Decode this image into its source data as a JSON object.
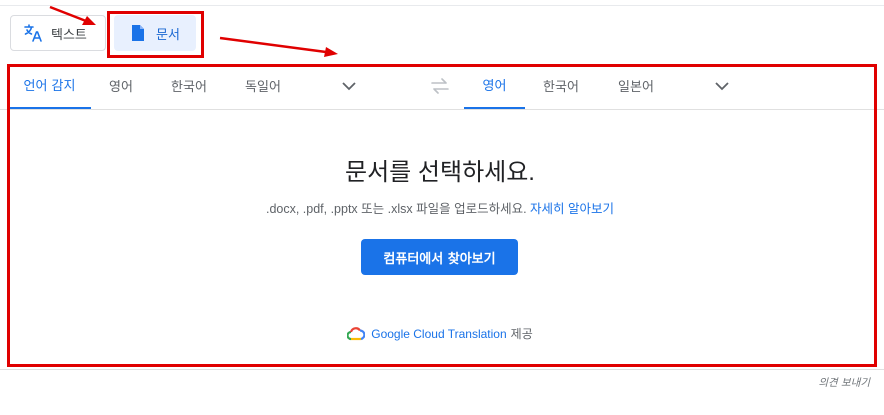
{
  "mode_tabs": {
    "text_label": "텍스트",
    "document_label": "문서"
  },
  "source_languages": [
    "언어 감지",
    "영어",
    "한국어",
    "독일어"
  ],
  "target_languages": [
    "영어",
    "한국어",
    "일본어"
  ],
  "dropzone": {
    "title": "문서를 선택하세요.",
    "subtitle": ".docx, .pdf, .pptx 또는 .xlsx 파일을 업로드하세요.",
    "learn_more": "자세히 알아보기",
    "browse_button": "컴퓨터에서 찾아보기"
  },
  "powered_by": {
    "link_text": "Google Cloud Translation",
    "suffix": "제공"
  },
  "feedback": "의견 보내기",
  "colors": {
    "accent": "#1a73e8",
    "annotation": "#e00000"
  },
  "icons": [
    "translate-icon",
    "document-icon",
    "chevron-down-icon",
    "swap-icon",
    "google-cloud-icon"
  ]
}
